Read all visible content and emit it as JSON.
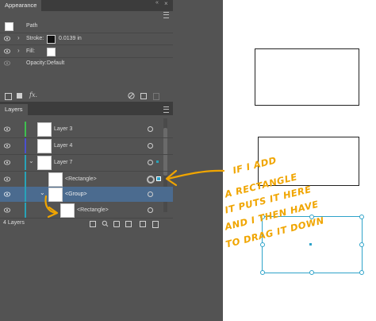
{
  "appearance": {
    "tab_label": "Appearance",
    "target_label": "Path",
    "stroke_label": "Stroke:",
    "stroke_value": "0.0139 in",
    "fill_label": "Fill:",
    "opacity_label": "Opacity:",
    "opacity_value": "Default",
    "fx_label": "fx."
  },
  "layers": {
    "tab_label": "Layers",
    "rows": [
      {
        "name": "Layer 3"
      },
      {
        "name": "Layer 4"
      },
      {
        "name": "Layer 7"
      },
      {
        "name": "<Rectangle>"
      },
      {
        "name": "<Group>"
      },
      {
        "name": "<Rectangle>"
      }
    ],
    "count_label": "4 Layers"
  },
  "annotation": {
    "lines": [
      "IF I ADD",
      "A RECTANGLE",
      "IT PUTS IT HERE",
      "AND I THEN HAVE",
      "TO DRAG IT DOWN"
    ]
  },
  "colors": {
    "panel_bg": "#535353",
    "selected_row": "#4b6b8f",
    "selection": "#2ea3c9",
    "annotation": "#f0a500",
    "layer3_color": "#3fbf4f",
    "layer4_color": "#4b4fd0",
    "layer7_color": "#28a3b8"
  }
}
